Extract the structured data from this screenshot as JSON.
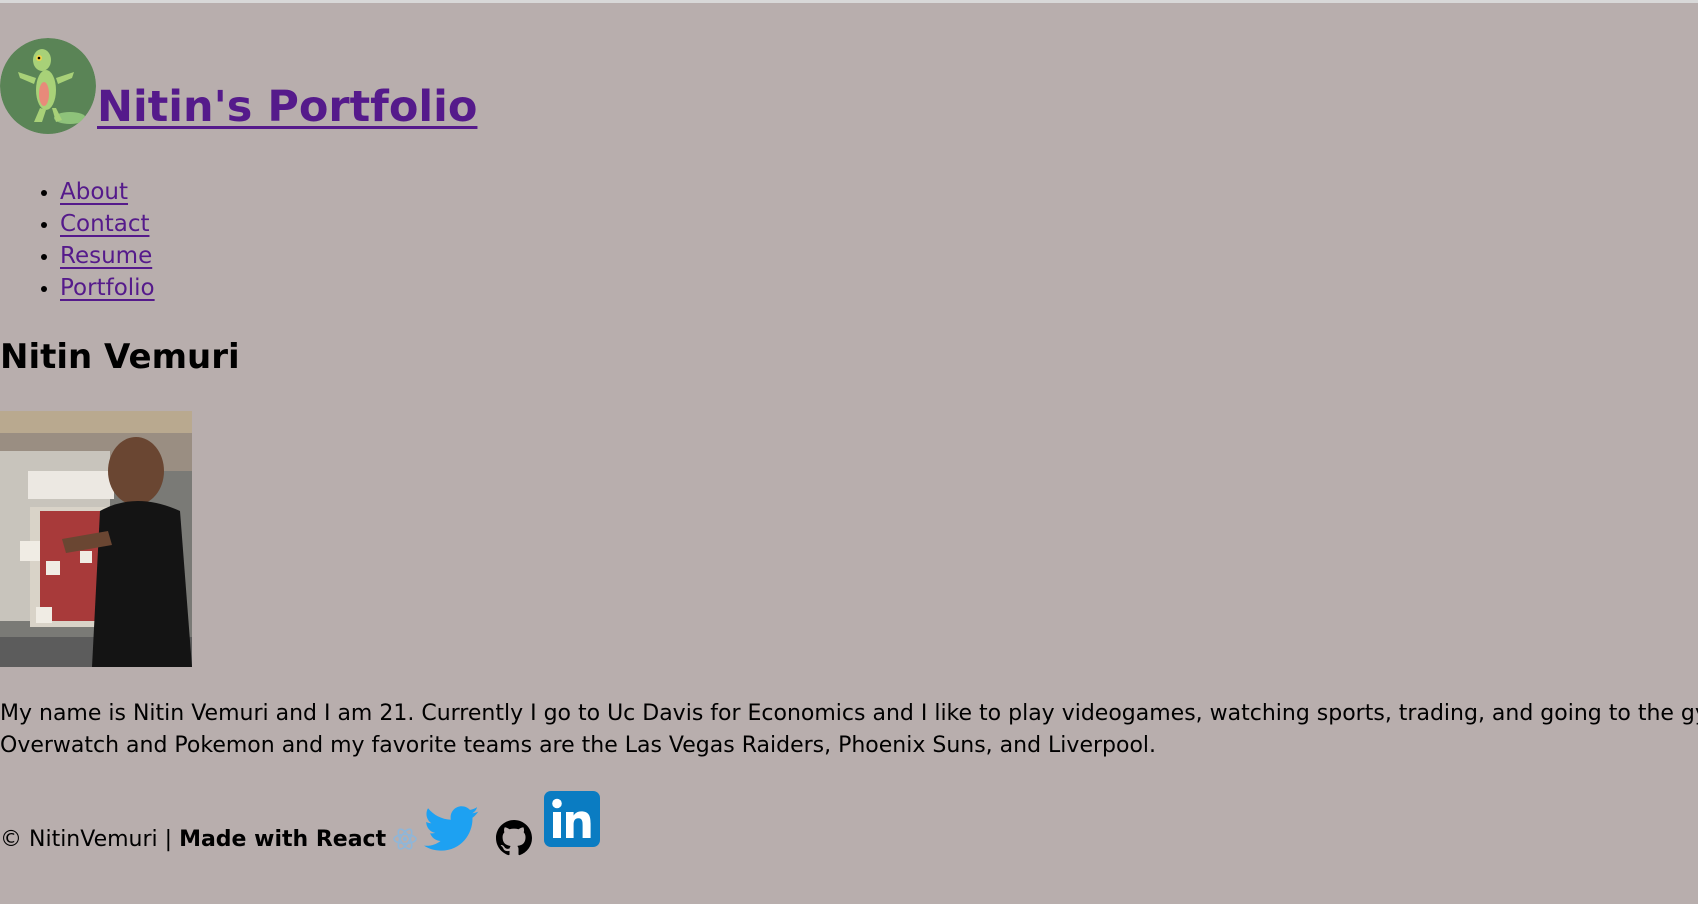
{
  "header": {
    "logo_alt": "frog avatar logo",
    "title": "Nitin's Portfolio"
  },
  "nav": {
    "items": [
      {
        "label": "About"
      },
      {
        "label": "Contact"
      },
      {
        "label": "Resume"
      },
      {
        "label": "Portfolio"
      }
    ]
  },
  "about": {
    "heading": "Nitin Vemuri",
    "photo_alt": "photo of Nitin",
    "bio_line1": "My name is Nitin Vemuri and I am 21. Currently I go to Uc Davis for Economics and I like to play videogames, watching sports, trading, and going to the gym. My",
    "bio_line2": "Overwatch and Pokemon and my favorite teams are the Las Vegas Raiders, Phoenix Suns, and Liverpool."
  },
  "footer": {
    "copyright": "© NitinVemuri | ",
    "made_with": "Made with React",
    "icons": [
      "react-icon",
      "twitter-icon",
      "github-icon",
      "linkedin-icon"
    ]
  },
  "colors": {
    "background": "#b8aead",
    "link": "#551a8b",
    "twitter": "#1da1f2",
    "linkedin": "#0a7cc2"
  }
}
